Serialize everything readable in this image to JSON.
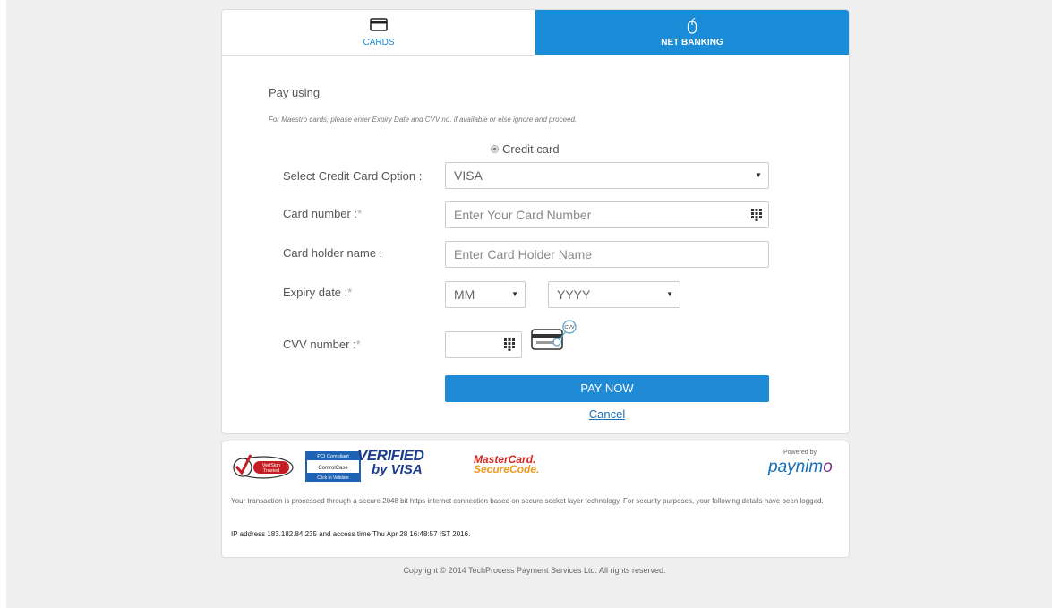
{
  "tabs": {
    "cards": "CARDS",
    "net_banking": "NET BANKING"
  },
  "form": {
    "pay_using": "Pay using",
    "note": "For Maestro cards, please enter Expiry Date and CVV no. if available or else ignore and proceed.",
    "radio_label": "Credit card",
    "select_option_label": "Select Credit Card Option :",
    "select_option_value": "VISA",
    "card_number_label": "Card number :",
    "card_number_placeholder": "Enter Your Card Number",
    "holder_label": "Card holder name :",
    "holder_placeholder": "Enter Card Holder Name",
    "expiry_label": "Expiry date :",
    "expiry_month": "MM",
    "expiry_year": "YYYY",
    "cvv_label": "CVV number :",
    "cvv_badge": "CVV",
    "required_mark": "*",
    "pay_now": "PAY NOW",
    "cancel": "Cancel"
  },
  "footer": {
    "verisign_line1": "VeriSign",
    "verisign_line2": "Trusted",
    "pci_top": "PCI Compliant",
    "pci_mid": "ControlCase",
    "pci_bottom": "Click to Validate",
    "verified_line1": "VERIFIED",
    "verified_line2": "by VISA",
    "mc_line1": "MasterCard.",
    "mc_line2": "SecureCode.",
    "powered_by": "Powered by",
    "paynimo_main": "paynim",
    "paynimo_o": "o",
    "security_text": "Your transaction is processed through a secure 2048 bit https internet connection based on secure socket layer technology. For security purposes, your following details have been logged.",
    "ip_text": "IP address 183.182.84.235 and access time Thu Apr 28 16:48:57 IST 2016."
  },
  "copyright": "Copyright © 2014 TechProcess Payment Services Ltd. All rights reserved.",
  "colors": {
    "accent": "#1a8cd8",
    "button": "#1f8ad5",
    "background": "#efefef",
    "mastercard_red": "#d9241f",
    "mastercard_orange": "#f29a1f",
    "visa_blue": "#1d3d8f"
  }
}
